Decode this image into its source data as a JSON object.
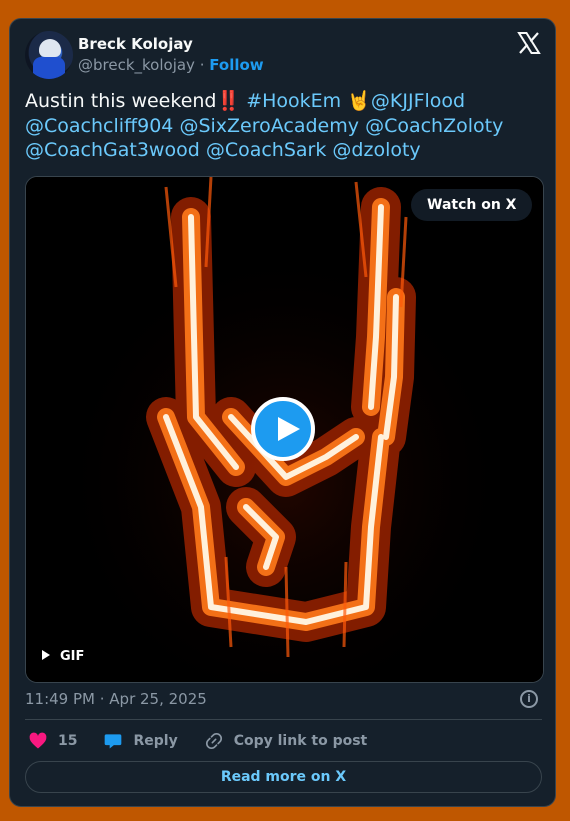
{
  "author": {
    "name": "Breck Kolojay",
    "handle": "@breck_kolojay",
    "separator": " · ",
    "follow_label": "Follow"
  },
  "tweet": {
    "text_plain": "Austin this weekend",
    "emoji_exclaim": "‼️",
    "hashtag": "#HookEm",
    "emoji_horns": "🤘",
    "mentions": [
      "@KJJFlood",
      "@Coachcliff904",
      "@SixZeroAcademy",
      "@CoachZoloty",
      "@CoachGat3wood",
      "@CoachSark",
      "@dzoloty"
    ]
  },
  "media": {
    "watch_label": "Watch on X",
    "gif_label": "GIF"
  },
  "timestamp": "11:49 PM · Apr 25, 2025",
  "actions": {
    "likes": "15",
    "reply_label": "Reply",
    "copy_label": "Copy link to post"
  },
  "read_more_label": "Read more on X",
  "colors": {
    "background": "#bf5700",
    "card": "#15202b",
    "link": "#6bc9fb",
    "accent": "#1d9bf0",
    "like": "#f91880"
  }
}
